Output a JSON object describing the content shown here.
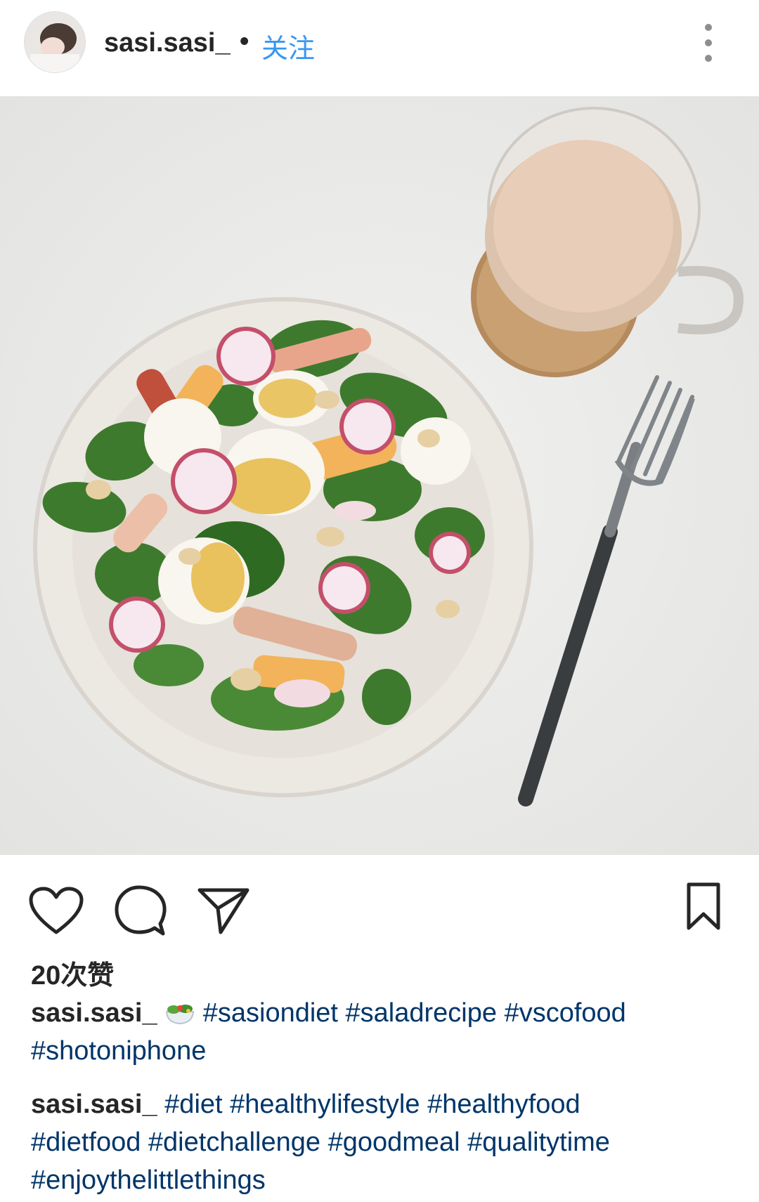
{
  "post": {
    "username": "sasi.sasi_",
    "separator": "•",
    "follow_label": "关注",
    "likes_text": "20次赞",
    "caption1": {
      "username": "sasi.sasi_",
      "emoji": "green-salad-emoji",
      "tags_line1": "#sasiondiet #saladrecipe #vscofood",
      "tags_line2": "#shotoniphone"
    },
    "caption2": {
      "username": "sasi.sasi_",
      "tags_line1": "#diet #healthylifestyle #healthyfood",
      "tags_line2": "#dietfood #dietchallenge #goodmeal #qualitytime",
      "tags_line3": "#enjoythelittlethings"
    }
  },
  "icons": [
    "avatar",
    "more-options-icon",
    "heart-icon",
    "comment-icon",
    "share-icon",
    "bookmark-icon"
  ],
  "colors": {
    "follow": "#3897f0",
    "hashtag": "#003569",
    "text": "#262626"
  }
}
